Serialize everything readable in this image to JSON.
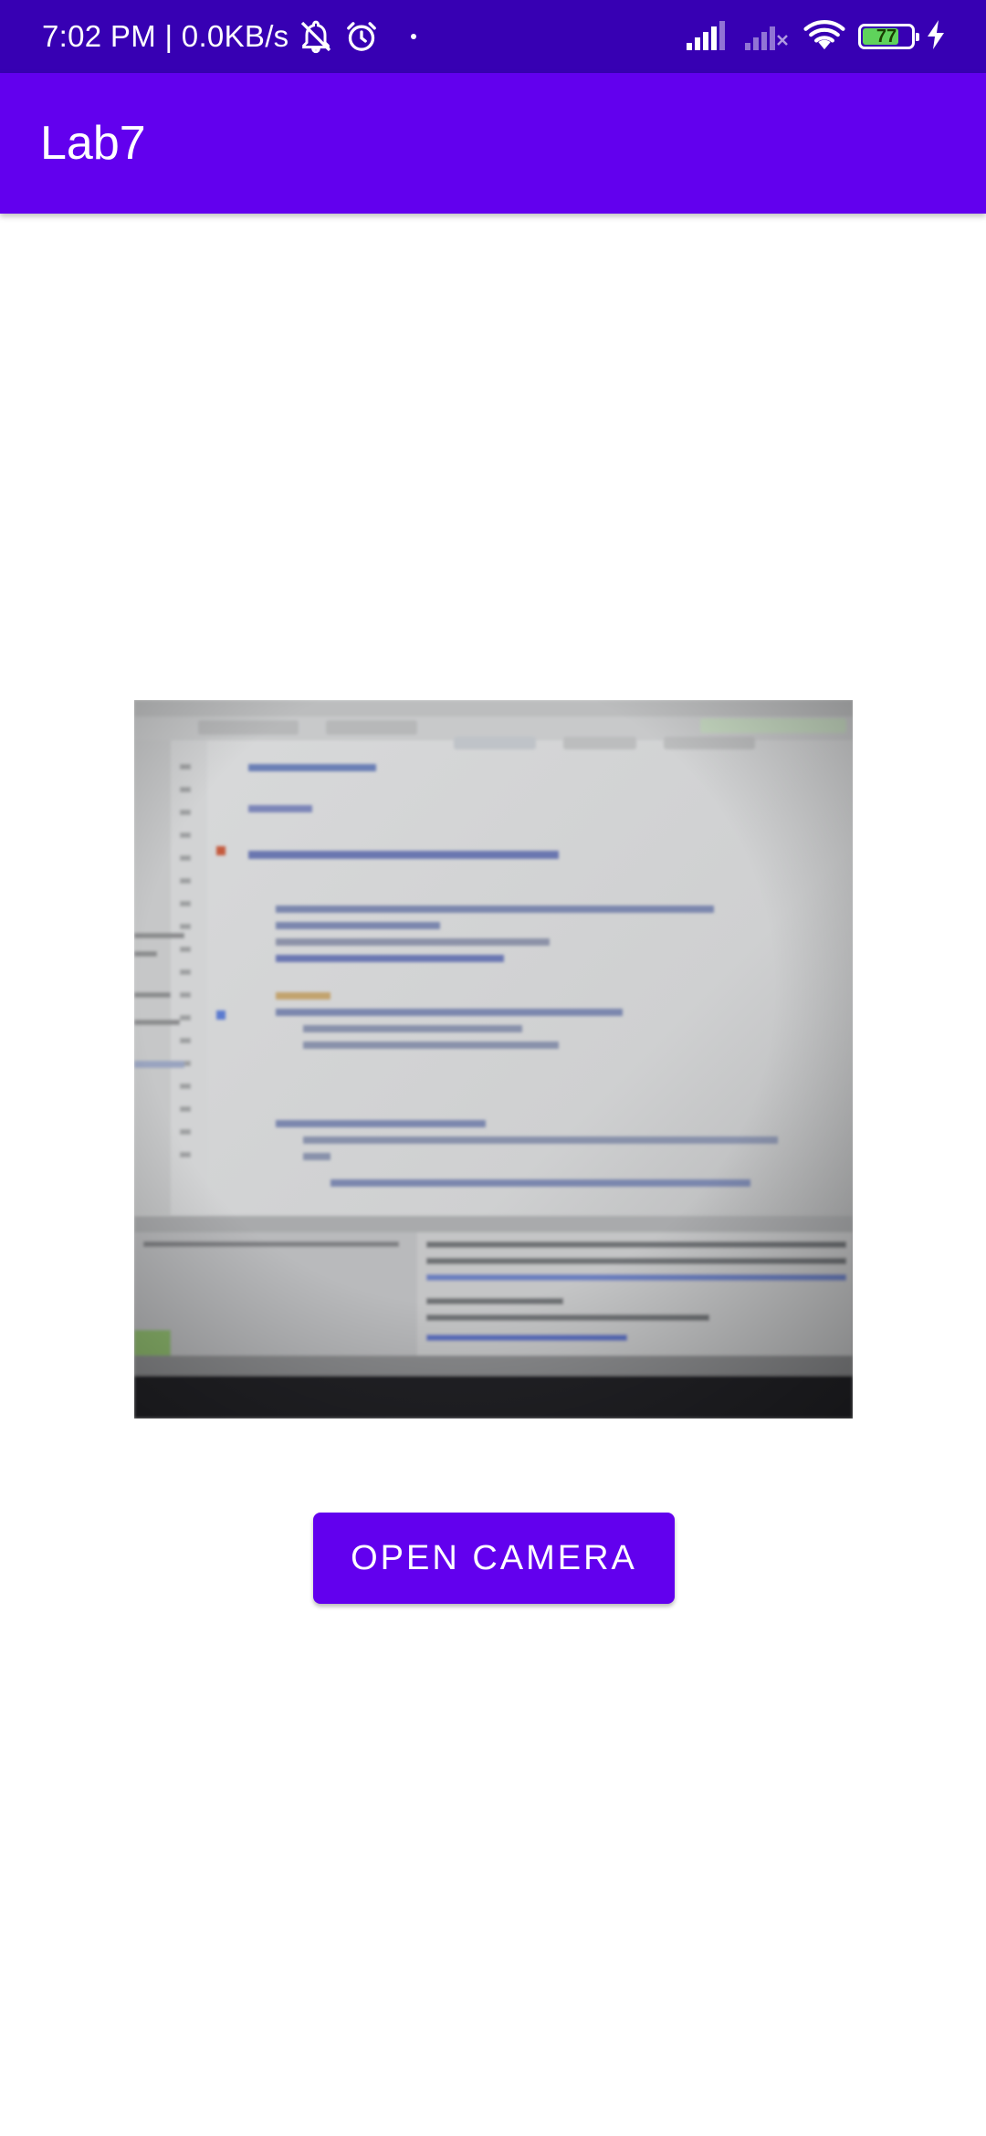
{
  "status_bar": {
    "time_speed": "7:02 PM | 0.0KB/s",
    "battery_level": "77",
    "icons": [
      "bell-off-icon",
      "alarm-icon",
      "signal-icon",
      "signal-2-icon",
      "wifi-icon",
      "battery-icon",
      "charging-icon"
    ]
  },
  "app_bar": {
    "title": "Lab7"
  },
  "main": {
    "photo_subject": "blurry photo of a monitor showing code in an IDE",
    "camera_button_label": "OPEN CAMERA"
  },
  "colors": {
    "status_bar": "#3700b3",
    "primary": "#6200ee",
    "battery_fill": "#5fd35b"
  }
}
